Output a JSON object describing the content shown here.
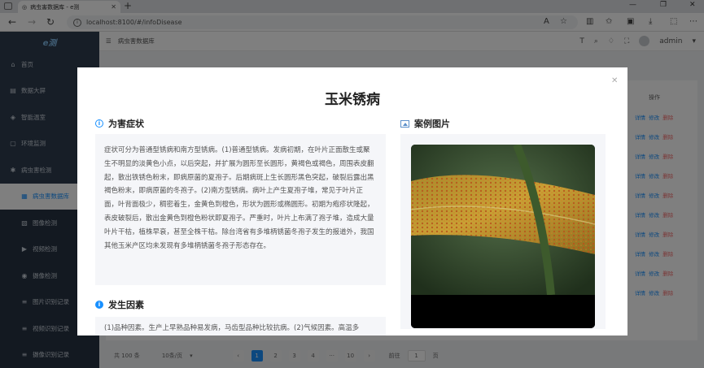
{
  "browser": {
    "tab_title": "病虫害数据库 - e测",
    "url": "localhost:8100/#/infoDisease"
  },
  "app": {
    "logo": "e测",
    "breadcrumb": "病虫害数据库",
    "user": "admin"
  },
  "sidebar": {
    "items": [
      {
        "label": "首页",
        "icon": "home-icon"
      },
      {
        "label": "数据大屏",
        "icon": "chart-icon"
      },
      {
        "label": "智能温室",
        "icon": "greenhouse-icon"
      },
      {
        "label": "环境监测",
        "icon": "monitor-icon"
      },
      {
        "label": "病虫害检测",
        "icon": "bug-icon"
      },
      {
        "label": "病虫害数据库",
        "icon": "database-icon"
      },
      {
        "label": "图像检测",
        "icon": "image-icon"
      },
      {
        "label": "视频检测",
        "icon": "video-icon"
      },
      {
        "label": "摄像检测",
        "icon": "camera-icon"
      },
      {
        "label": "图片识别记录",
        "icon": "record-icon"
      },
      {
        "label": "视频识别记录",
        "icon": "record-icon"
      },
      {
        "label": "摄像识别记录",
        "icon": "record-icon"
      }
    ]
  },
  "table": {
    "ops_header": "操作",
    "row_actions": [
      "详情",
      "修改",
      "删除"
    ]
  },
  "pagination": {
    "total": "共 100 条",
    "page_size": "10条/页",
    "pages": [
      "1",
      "2",
      "3",
      "4",
      "···",
      "10"
    ],
    "current": "1",
    "goto_prefix": "前往",
    "goto_value": "1",
    "goto_suffix": "页"
  },
  "modal": {
    "title": "玉米锈病",
    "symptoms_title": "为害症状",
    "symptoms_text": "症状可分为普通型锈病和南方型锈病。(1)普通型锈病。发病初期，在叶片正面散生或聚生不明显的淡黄色小点，以后突起，并扩展为圆形至长圆形，黄褐色或褐色，周围表皮翻起，散出铁锈色粉末，即病原菌的夏孢子。后期病斑上生长圆形黑色突起，破裂后露出黑褐色粉末，即病原菌的冬孢子。(2)南方型锈病。病叶上产生夏孢子堆，常见于叶片正面，叶背面极少，稠密着生，金黄色到橙色，形状为圆形或椭圆形。初期为疱疹状隆起，表皮破裂后，散出金黄色到橙色粉状即夏孢子。严重时，叶片上布满了孢子堆，造成大量叶片干枯，植株早衰，甚至全株干枯。除台湾省有多堆柄锈菌冬孢子发生的报道外，我国其他玉米产区均未发现有多堆柄锈菌冬孢子形态存在。",
    "causes_title": "发生因素",
    "causes_text": "(1)品种因素。生产上早熟品种易发病，马齿型品种比较抗病。(2)气候因素。高温多",
    "image_title": "案例图片"
  }
}
